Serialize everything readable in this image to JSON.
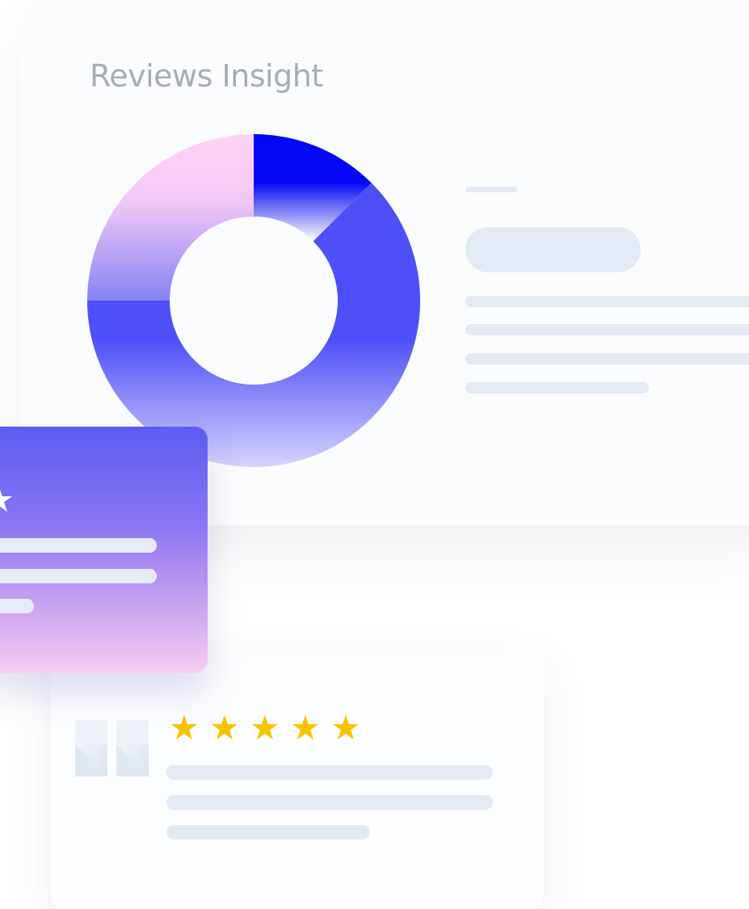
{
  "insight": {
    "title": "Reviews Insight"
  },
  "donut": {
    "segments": [
      {
        "name": "blue",
        "fraction": 0.125,
        "color_top": "#0008f2",
        "color_bottom": "#ffffff"
      },
      {
        "name": "indigo",
        "fraction": 0.625,
        "color_top": "#4d50f8",
        "color_bottom": "#d3cffd"
      },
      {
        "name": "lavender",
        "fraction": 0.25,
        "color_top": "#ffd3f5",
        "color_bottom": "#8b87f5"
      }
    ]
  },
  "review_card": {
    "stars": [
      "★",
      "★",
      "★",
      "★",
      "★"
    ],
    "star_color": "#f8c400"
  },
  "purple_card": {
    "star": "★"
  },
  "colors": {
    "placeholder": "#e3eaf3",
    "panel": "#fbfcfd",
    "accent": "#4d50f8"
  }
}
